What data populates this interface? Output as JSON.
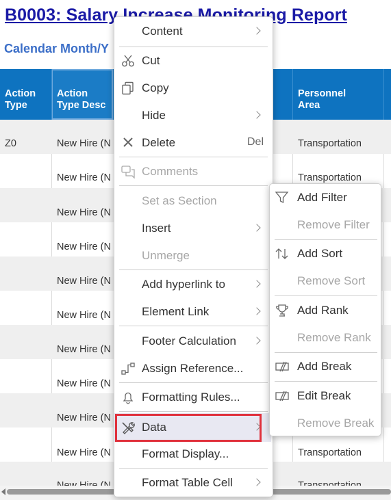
{
  "report": {
    "title": "B0003: Salary Increase Monitoring Report",
    "subtitle": "Calendar Month/Y"
  },
  "table": {
    "headers": [
      {
        "line1": "Action",
        "line2": "Type"
      },
      {
        "line1": "Action",
        "line2": "Type Desc"
      },
      {
        "line1": "Personnel",
        "line2": "Area"
      }
    ],
    "rows": [
      {
        "type": "Z0",
        "desc": "New Hire (N",
        "area": "Transportation"
      },
      {
        "type": "",
        "desc": "New Hire (N",
        "area": "Transportation"
      },
      {
        "type": "",
        "desc": "New Hire (N",
        "area": ""
      },
      {
        "type": "",
        "desc": "New Hire (N",
        "area": ""
      },
      {
        "type": "",
        "desc": "New Hire (N",
        "area": ""
      },
      {
        "type": "",
        "desc": "New Hire (N",
        "area": ""
      },
      {
        "type": "",
        "desc": "New Hire (N",
        "area": ""
      },
      {
        "type": "",
        "desc": "New Hire (N",
        "area": ""
      },
      {
        "type": "",
        "desc": "New Hire (N",
        "area": ""
      },
      {
        "type": "",
        "desc": "New Hire (N",
        "area": "Transportation"
      },
      {
        "type": "",
        "desc": "New Hire (N",
        "area": "Transportation"
      }
    ]
  },
  "context_menu": {
    "items": [
      {
        "label": "Content",
        "icon": "",
        "submenu": true,
        "disabled": false
      },
      {
        "label": "Cut",
        "icon": "scissors-icon",
        "submenu": false,
        "disabled": false
      },
      {
        "label": "Copy",
        "icon": "copy-icon",
        "submenu": false,
        "disabled": false
      },
      {
        "label": "Hide",
        "icon": "",
        "submenu": true,
        "disabled": false
      },
      {
        "label": "Delete",
        "icon": "delete-x-icon",
        "shortcut": "Del",
        "submenu": false,
        "disabled": false
      },
      {
        "label": "Comments",
        "icon": "comments-icon",
        "submenu": false,
        "disabled": true
      },
      {
        "label": "Set as Section",
        "icon": "",
        "submenu": false,
        "disabled": true
      },
      {
        "label": "Insert",
        "icon": "",
        "submenu": true,
        "disabled": false
      },
      {
        "label": "Unmerge",
        "icon": "",
        "submenu": false,
        "disabled": true
      },
      {
        "label": "Add hyperlink to",
        "icon": "",
        "submenu": true,
        "disabled": false
      },
      {
        "label": "Element Link",
        "icon": "",
        "submenu": true,
        "disabled": false
      },
      {
        "label": "Footer Calculation",
        "icon": "",
        "submenu": true,
        "disabled": false
      },
      {
        "label": "Assign Reference...",
        "icon": "assign-reference-icon",
        "submenu": false,
        "disabled": false
      },
      {
        "label": "Formatting Rules...",
        "icon": "bell-icon",
        "submenu": false,
        "disabled": false
      },
      {
        "label": "Data",
        "icon": "tools-icon",
        "submenu": true,
        "disabled": false,
        "highlighted": true
      },
      {
        "label": "Format Display...",
        "icon": "",
        "submenu": false,
        "disabled": false
      },
      {
        "label": "Format Table Cell",
        "icon": "",
        "submenu": true,
        "disabled": false
      }
    ]
  },
  "data_submenu": {
    "items": [
      {
        "label": "Add Filter",
        "icon": "filter-icon",
        "disabled": false
      },
      {
        "label": "Remove Filter",
        "icon": "",
        "disabled": true
      },
      {
        "label": "Add Sort",
        "icon": "sort-icon",
        "disabled": false
      },
      {
        "label": "Remove Sort",
        "icon": "",
        "disabled": true
      },
      {
        "label": "Add Rank",
        "icon": "trophy-icon",
        "disabled": false
      },
      {
        "label": "Remove Rank",
        "icon": "",
        "disabled": true
      },
      {
        "label": "Add Break",
        "icon": "break-icon",
        "disabled": false
      },
      {
        "label": "Edit Break",
        "icon": "break-icon",
        "disabled": false
      },
      {
        "label": "Remove Break",
        "icon": "",
        "disabled": true
      }
    ]
  },
  "colors": {
    "header_bg": "#0e73c0",
    "highlight_border": "#e0313c",
    "title": "#1a1aa6",
    "subtitle": "#3c6fc8"
  }
}
